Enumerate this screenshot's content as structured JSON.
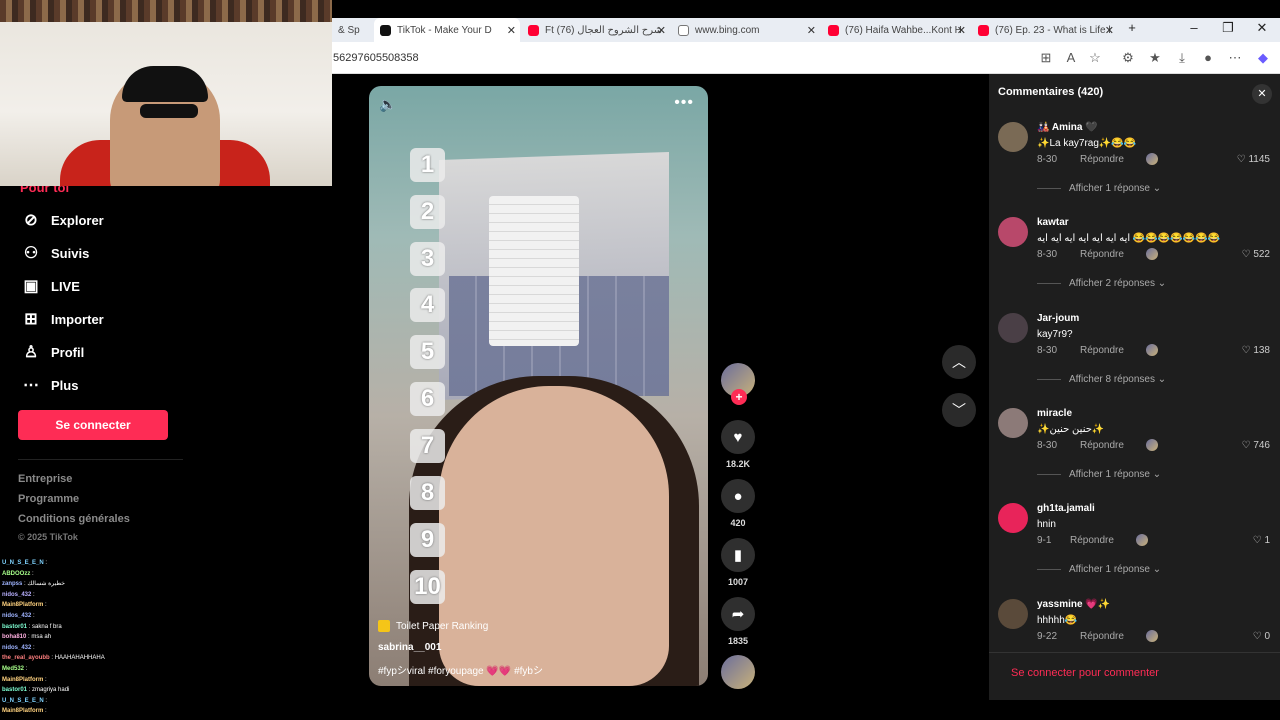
{
  "browser": {
    "tabs": [
      {
        "label": "& Sp",
        "icon": "youtube-icon"
      },
      {
        "label": "TikTok - Make Your D",
        "icon": "tiktok-icon",
        "active": true
      },
      {
        "label": "Ft شرح الشروح العجال (76)",
        "icon": "youtube-icon"
      },
      {
        "label": "www.bing.com",
        "icon": "bing-icon"
      },
      {
        "label": "(76) Haifa Wahbe...Kont H",
        "icon": "youtube-icon"
      },
      {
        "label": "(76) Ep. 23 - What is Life l",
        "icon": "youtube-icon"
      }
    ],
    "url": "56297605508358"
  },
  "sidebar": {
    "partial_item": "Pour toi",
    "items": [
      {
        "label": "Explorer",
        "icon": "compass-icon"
      },
      {
        "label": "Suivis",
        "icon": "following-icon"
      },
      {
        "label": "LIVE",
        "icon": "live-icon"
      },
      {
        "label": "Importer",
        "icon": "upload-icon"
      },
      {
        "label": "Profil",
        "icon": "profile-icon"
      },
      {
        "label": "Plus",
        "icon": "more-icon"
      }
    ],
    "login_button": "Se connecter",
    "footer_links": [
      "Entreprise",
      "Programme",
      "Conditions générales"
    ],
    "copyright": "© 2025 TikTok"
  },
  "chat": [
    {
      "user": "U_N_S_E_E_N",
      "msg": ""
    },
    {
      "user": "ABDOOzz",
      "msg": ""
    },
    {
      "user": "zanpss",
      "msg": "خطيرة شسالك"
    },
    {
      "user": "nidos_432",
      "msg": ""
    },
    {
      "user": "Main8Platform",
      "msg": ""
    },
    {
      "user": "nidos_432",
      "msg": ""
    },
    {
      "user": "bastor01",
      "msg": "sakna f bra"
    },
    {
      "user": "boha810",
      "msg": "msa ah"
    },
    {
      "user": "nidos_432",
      "msg": ""
    },
    {
      "user": "the_real_ayoubb",
      "msg": "HAAHAHAHHAHA"
    },
    {
      "user": "Med532",
      "msg": ""
    },
    {
      "user": "Main8Platform",
      "msg": ""
    },
    {
      "user": "bastor01",
      "msg": "zmagriya hadi"
    },
    {
      "user": "U_N_S_E_E_N",
      "msg": ""
    },
    {
      "user": "Main8Platform",
      "msg": ""
    }
  ],
  "video": {
    "ranks": [
      "1",
      "2",
      "3",
      "4",
      "5",
      "6",
      "7",
      "8",
      "9",
      "10"
    ],
    "tag": "Toilet Paper Ranking",
    "author": "sabrina__001",
    "hashtags": "#fypシviral #foryoupage 💗💗 #fybシ"
  },
  "actions": {
    "likes": "18.2K",
    "comments": "420",
    "saves": "1007",
    "shares": "1835"
  },
  "comments_panel": {
    "title": "Commentaires (420)",
    "login_prompt": "Se connecter pour commenter",
    "items": [
      {
        "name": "🎎 Amina 🖤",
        "text": "✨La kay7rag✨😂😂",
        "date": "8-30",
        "reply": "Répondre",
        "likes": "1145",
        "view": "Afficher 1 réponse ⌄",
        "avatar_color": "#7a6a55"
      },
      {
        "name": "kawtar",
        "text": "ايه ايه ايه ايه ايه ايه ايه 😂😂😂😂😂😂😂",
        "date": "8-30",
        "reply": "Répondre",
        "likes": "522",
        "view": "Afficher 2 réponses ⌄",
        "avatar_color": "#b8486a"
      },
      {
        "name": "Jar-joum",
        "text": "kay7r9?",
        "date": "8-30",
        "reply": "Répondre",
        "likes": "138",
        "view": "Afficher 8 réponses ⌄",
        "avatar_color": "#4a3f46"
      },
      {
        "name": "miracle",
        "text": "✨حنين حنين✨",
        "date": "8-30",
        "reply": "Répondre",
        "likes": "746",
        "view": "Afficher 1 réponse ⌄",
        "avatar_color": "#8c7a78"
      },
      {
        "name": "gh1ta.jamali",
        "text": "hnin",
        "date": "9-1",
        "reply": "Répondre",
        "likes": "1",
        "view": "Afficher 1 réponse ⌄",
        "avatar_color": "#e8245a"
      },
      {
        "name": "yassmine 💗✨",
        "text": "hhhhh😂",
        "date": "9-22",
        "reply": "Répondre",
        "likes": "0",
        "view": "",
        "avatar_color": "#5a4a3a"
      }
    ]
  }
}
